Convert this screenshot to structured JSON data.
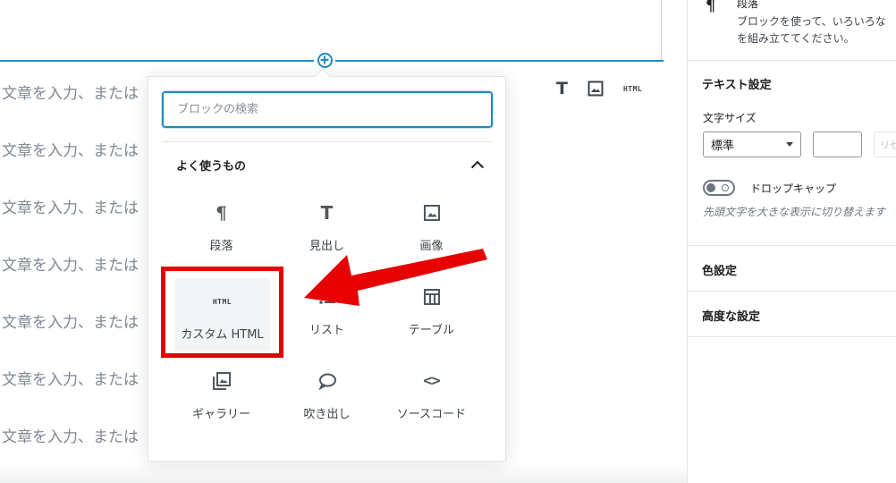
{
  "editor": {
    "placeholder_rows": [
      "文章を入力、または",
      "文章を入力、または",
      "文章を入力、または",
      "文章を入力、または",
      "文章を入力、または",
      "文章を入力、または",
      "文章を入力、または"
    ],
    "inline_tools": {
      "heading_glyph": "T",
      "html_glyph": "HTML"
    }
  },
  "inserter": {
    "search_placeholder": "ブロックの検索",
    "panel_title": "よく使うもの",
    "blocks": [
      {
        "label": "段落",
        "icon": "paragraph-icon",
        "glyph": "¶"
      },
      {
        "label": "見出し",
        "icon": "heading-icon",
        "glyph": "T"
      },
      {
        "label": "画像",
        "icon": "image-icon"
      },
      {
        "label": "カスタム HTML",
        "icon": "html-icon",
        "glyph": "HTML"
      },
      {
        "label": "リスト",
        "icon": "list-icon"
      },
      {
        "label": "テーブル",
        "icon": "table-icon"
      },
      {
        "label": "ギャラリー",
        "icon": "gallery-icon"
      },
      {
        "label": "吹き出し",
        "icon": "speech-bubble-icon"
      },
      {
        "label": "ソースコード",
        "icon": "code-icon",
        "glyph": "<>"
      }
    ],
    "highlight_color": "#e60000",
    "accent_color": "#1e8cbe"
  },
  "sidebar": {
    "block_card": {
      "glyph": "¶",
      "title": "段落",
      "description_lines": [
        "ブロックを使って、いろいろな",
        "を組み立ててください。"
      ]
    },
    "text_settings": {
      "title": "テキスト設定",
      "font_size_label": "文字サイズ",
      "font_size_value": "標準",
      "reset_label": "リセット",
      "drop_cap_label": "ドロップキャップ",
      "drop_cap_help": "先頭文字を大きな表示に切り替えます"
    },
    "color_settings_title": "色設定",
    "advanced_settings_title": "高度な設定"
  }
}
